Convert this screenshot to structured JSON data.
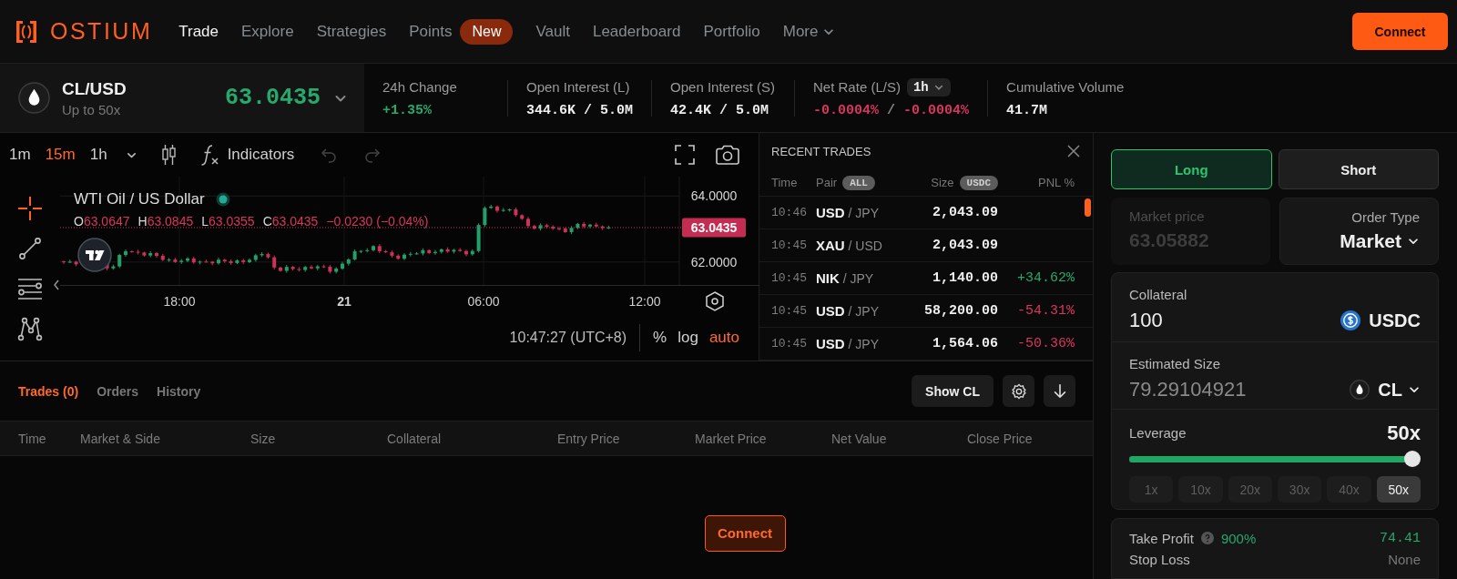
{
  "nav": {
    "logo": "OSTIUM",
    "items": [
      {
        "label": "Trade",
        "kind": "link",
        "selected": true
      },
      {
        "label": "Explore",
        "kind": "link",
        "selected": false
      },
      {
        "label": "Strategies",
        "kind": "link",
        "selected": false
      },
      {
        "label": "Points",
        "kind": "link",
        "selected": false,
        "badge": "New"
      },
      {
        "label": "Vault",
        "kind": "link",
        "selected": false
      },
      {
        "label": "Leaderboard",
        "kind": "link",
        "selected": false
      },
      {
        "label": "Portfolio",
        "kind": "link",
        "selected": false
      },
      {
        "label": "More",
        "kind": "dropdown",
        "selected": false
      }
    ],
    "connect_button": "Connect"
  },
  "ticker": {
    "pair": "CL/USD",
    "subtitle": "Up to 50x",
    "price": "63.0435",
    "stats": [
      {
        "label": "24h Change",
        "kind": "single",
        "value": "+1.35%",
        "color": "#27a86c"
      },
      {
        "label": "Open Interest (L)",
        "kind": "single",
        "value": "344.6K / 5.0M",
        "color": "#eeeeee"
      },
      {
        "label": "Open Interest (S)",
        "kind": "single",
        "value": "42.4K / 5.0M",
        "color": "#eeeeee"
      },
      {
        "label": "Net Rate (L/S)",
        "kind": "pair",
        "dropdown": "1h",
        "values": [
          "-0.0004%",
          "-0.0004%"
        ],
        "separator": "/",
        "color": "#d9365e"
      },
      {
        "label": "Cumulative Volume",
        "kind": "single",
        "value": "41.7M",
        "color": "#eeeeee"
      }
    ]
  },
  "chart": {
    "toolbar": {
      "intervals": [
        {
          "label": "1m",
          "selected": false
        },
        {
          "label": "15m",
          "selected": true
        },
        {
          "label": "1h",
          "selected": false
        }
      ],
      "indicators": "Indicators",
      "undo": {
        "disabled": true
      },
      "redo": {
        "disabled": true
      }
    },
    "tools": [
      {
        "kind": "crosshair",
        "selected": true
      },
      {
        "kind": "trend-line",
        "selected": false
      },
      {
        "kind": "horizontal-lines",
        "selected": false
      },
      {
        "kind": "pattern",
        "selected": false
      }
    ],
    "title": "WTI Oil / US Dollar",
    "ohlc": [
      {
        "key": "O",
        "value": "63.0647"
      },
      {
        "key": "H",
        "value": "63.0845"
      },
      {
        "key": "L",
        "value": "63.0355"
      },
      {
        "key": "C",
        "value": "63.0435"
      }
    ],
    "change": {
      "label": "−0.0230 (−0.04%)",
      "color": "#d9365e"
    },
    "price_ticks": [
      "64.0000",
      "62.0000"
    ],
    "price_tag": "63.0435",
    "time_ticks": [
      {
        "label": "18:00",
        "kind": "time"
      },
      {
        "label": "21",
        "kind": "day"
      },
      {
        "label": "06:00",
        "kind": "time"
      },
      {
        "label": "12:00",
        "kind": "time"
      }
    ],
    "clock": "10:47:27 (UTC+8)",
    "scale_options": [
      {
        "label": "%",
        "selected": false
      },
      {
        "label": "log",
        "selected": false
      },
      {
        "label": "auto",
        "selected": true
      }
    ]
  },
  "recent_trades": {
    "title": "RECENT TRADES",
    "columns": [
      {
        "label": "Time"
      },
      {
        "label": "Pair",
        "badge": "ALL"
      },
      {
        "label": "Size",
        "badge": "USDC"
      },
      {
        "label": "PNL %"
      }
    ],
    "rows": [
      {
        "time": "10:46",
        "base": "USD",
        "quote": "/ JPY",
        "size": "2,043.09"
      },
      {
        "time": "10:45",
        "base": "XAU",
        "quote": "/ USD",
        "size": "2,043.09"
      },
      {
        "time": "10:45",
        "base": "NIK",
        "quote": "/ JPY",
        "size": "1,140.00",
        "pnl": "+34.62%",
        "color": "#27a86c"
      },
      {
        "time": "10:45",
        "base": "USD",
        "quote": "/ JPY",
        "size": "58,200.00",
        "pnl": "-54.31%",
        "color": "#d9365e"
      },
      {
        "time": "10:45",
        "base": "USD",
        "quote": "/ JPY",
        "size": "1,564.06",
        "pnl": "-50.36%",
        "color": "#d9365e"
      }
    ]
  },
  "positions": {
    "tabs": [
      {
        "label": "Trades (0)",
        "selected": true
      },
      {
        "label": "Orders",
        "selected": false
      },
      {
        "label": "History",
        "selected": false
      }
    ],
    "show_button": "Show CL",
    "columns": [
      "Time",
      "Market & Side",
      "Size",
      "Collateral",
      "Entry Price",
      "Market Price",
      "Net Value",
      "Close Price"
    ],
    "connect_button": "Connect"
  },
  "order": {
    "sides": [
      {
        "label": "Long",
        "kind": "long",
        "selected": true
      },
      {
        "label": "Short",
        "kind": "short",
        "selected": false
      }
    ],
    "market_price": {
      "label": "Market price",
      "value": "63.05882",
      "disabled": true
    },
    "order_type": {
      "label": "Order Type",
      "value": "Market"
    },
    "collateral": {
      "label": "Collateral",
      "value": "100",
      "token": "USDC"
    },
    "estimated_size": {
      "label": "Estimated Size",
      "value": "79.29104921",
      "token": "CL"
    },
    "leverage": {
      "label": "Leverage",
      "value": "50x",
      "level": 1,
      "presets": [
        {
          "label": "1x",
          "selected": false
        },
        {
          "label": "10x",
          "selected": false
        },
        {
          "label": "20x",
          "selected": false
        },
        {
          "label": "30x",
          "selected": false
        },
        {
          "label": "40x",
          "selected": false
        },
        {
          "label": "50x",
          "selected": true
        }
      ]
    },
    "take_profit": {
      "label": "Take Profit",
      "percent": "900%",
      "value": "74.41"
    },
    "stop_loss": {
      "label": "Stop Loss",
      "value": "None"
    }
  }
}
